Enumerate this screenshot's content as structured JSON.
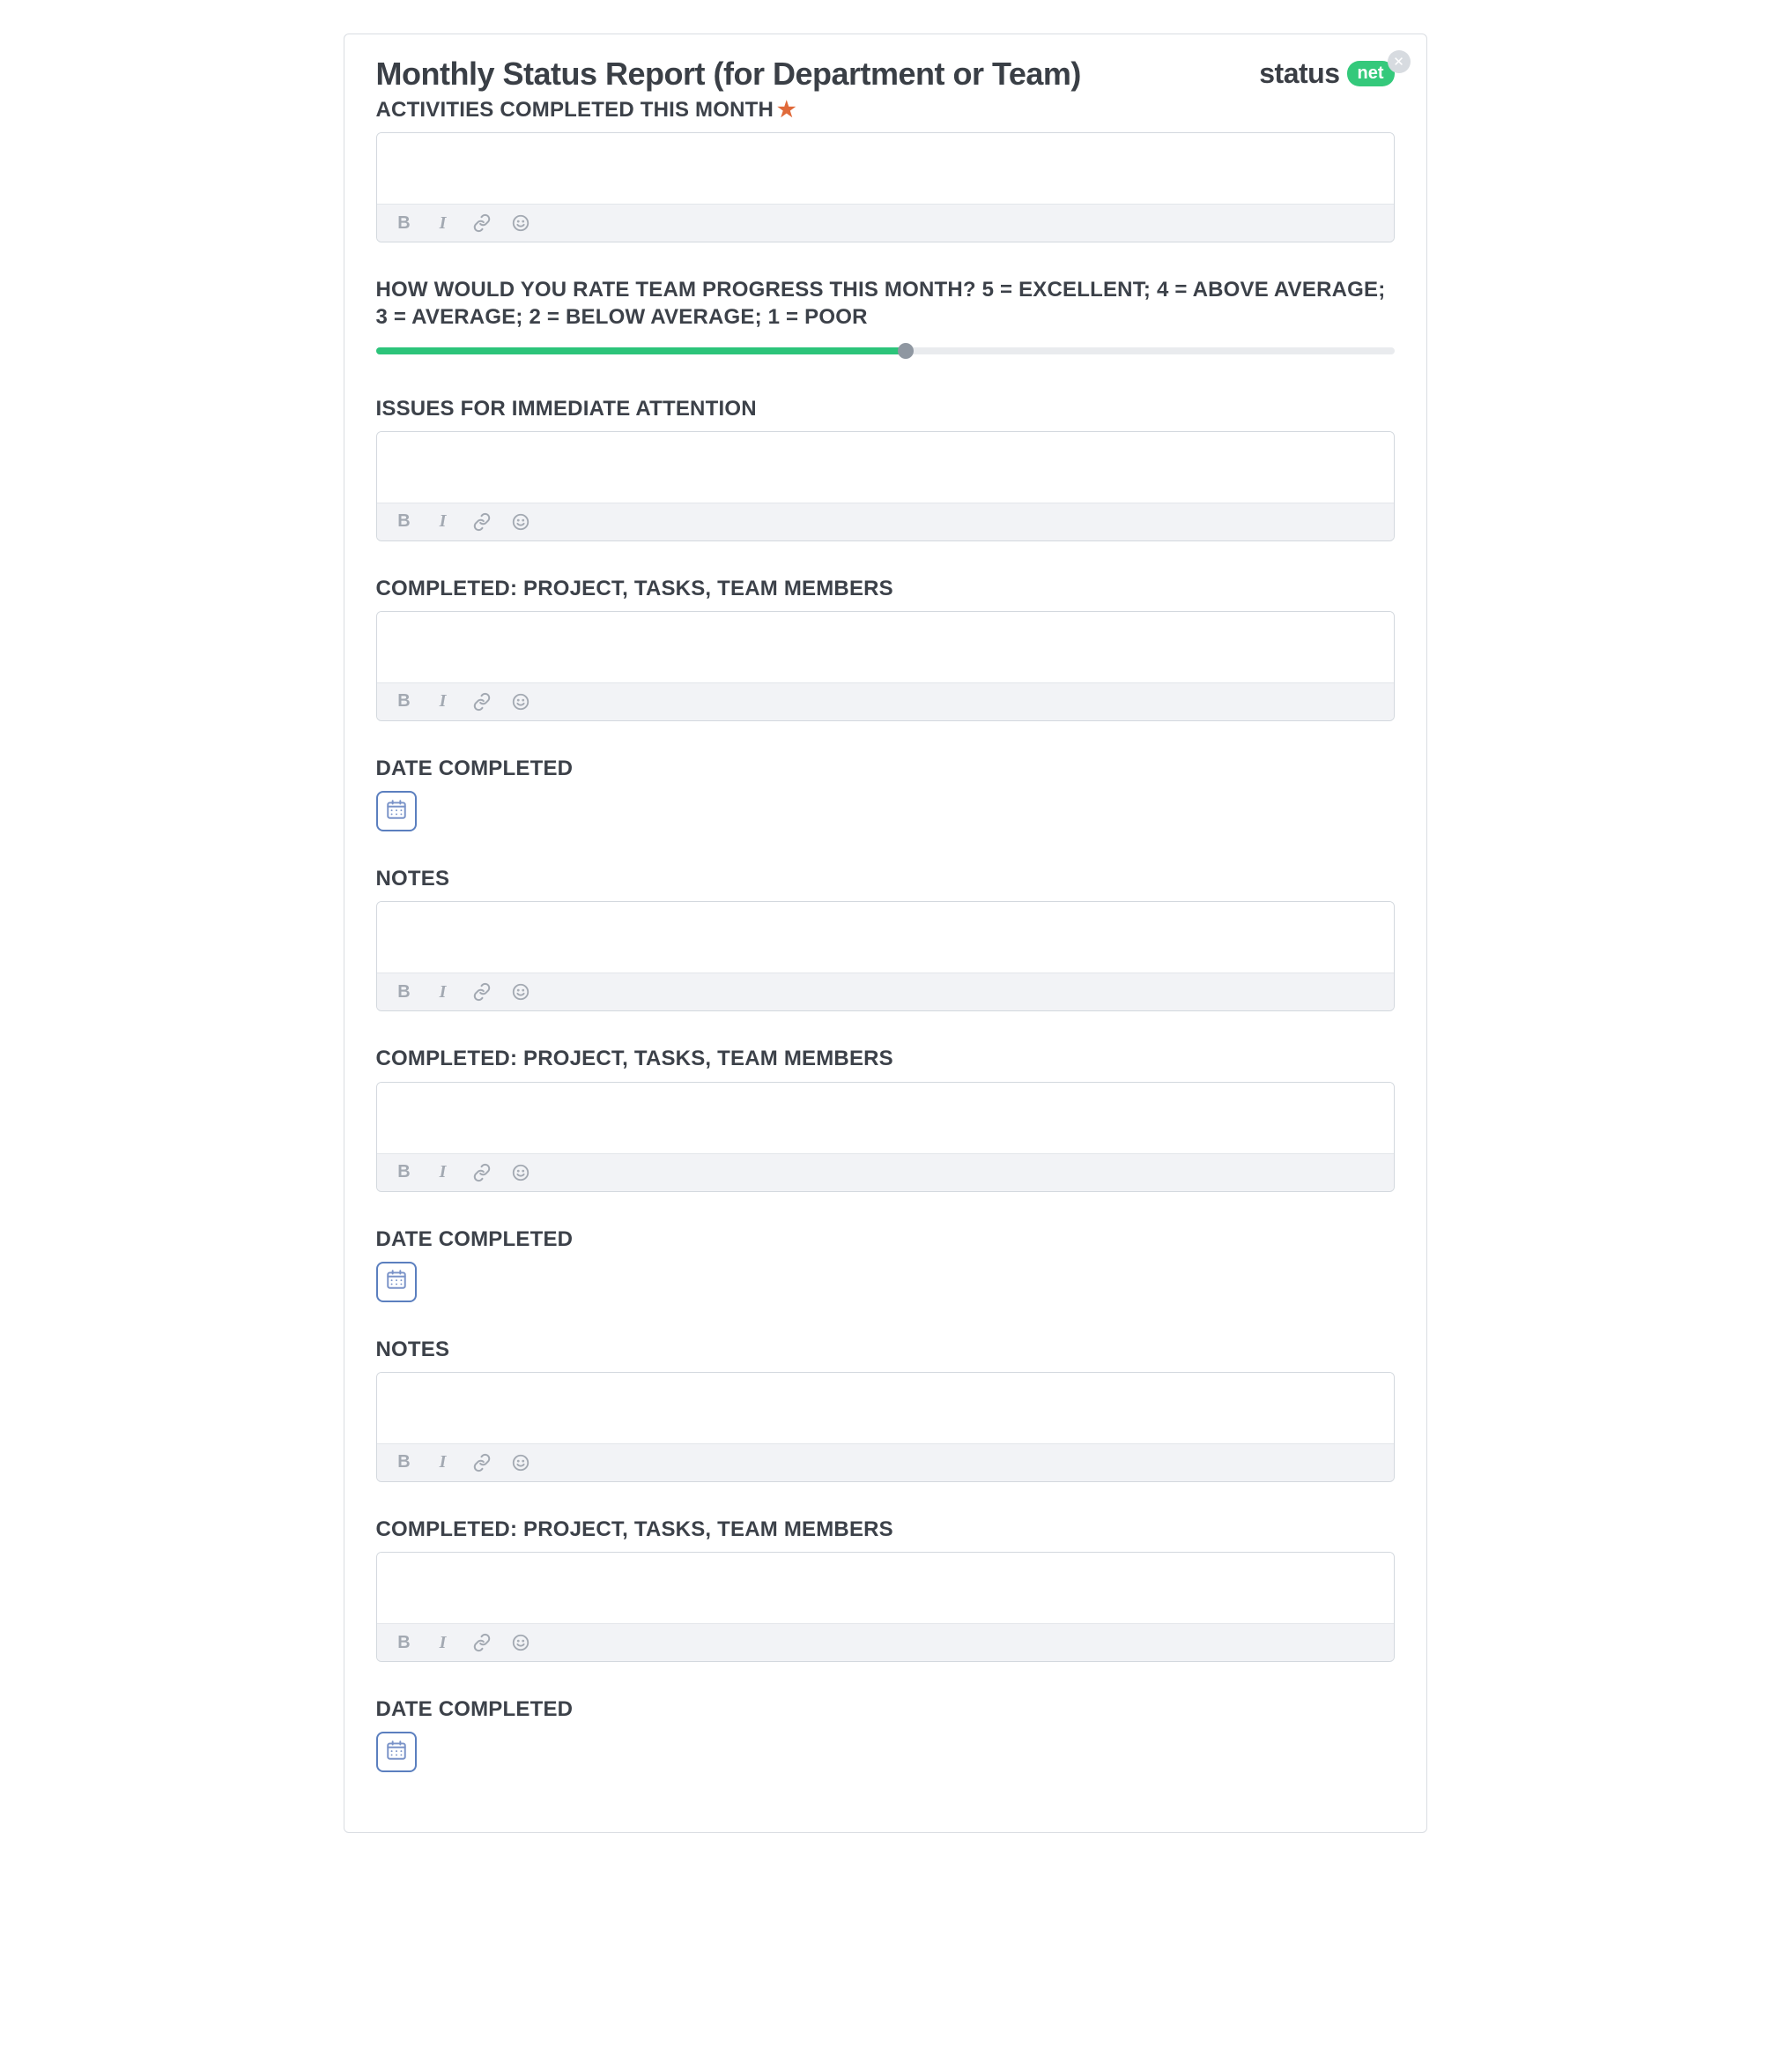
{
  "header": {
    "title": "Monthly Status Report (for Department or Team)",
    "brand_status": "status",
    "brand_net": "net"
  },
  "slider": {
    "fill_percent": 52
  },
  "sections": [
    {
      "label": "ACTIVITIES COMPLETED THIS MONTH",
      "required": true,
      "type": "rte"
    },
    {
      "label": "HOW WOULD YOU RATE TEAM PROGRESS THIS MONTH? 5 = EXCELLENT; 4 = ABOVE AVERAGE; 3 = AVERAGE; 2 = BELOW AVERAGE; 1 = POOR",
      "type": "slider"
    },
    {
      "label": "ISSUES FOR IMMEDIATE ATTENTION",
      "type": "rte"
    },
    {
      "label": "COMPLETED: PROJECT, TASKS, TEAM MEMBERS",
      "type": "rte"
    },
    {
      "label": "DATE COMPLETED",
      "type": "date"
    },
    {
      "label": "NOTES",
      "type": "rte"
    },
    {
      "label": "COMPLETED: PROJECT, TASKS, TEAM MEMBERS",
      "type": "rte"
    },
    {
      "label": "DATE COMPLETED",
      "type": "date"
    },
    {
      "label": "NOTES",
      "type": "rte"
    },
    {
      "label": "COMPLETED: PROJECT, TASKS, TEAM MEMBERS",
      "type": "rte"
    },
    {
      "label": "DATE COMPLETED",
      "type": "date"
    }
  ]
}
